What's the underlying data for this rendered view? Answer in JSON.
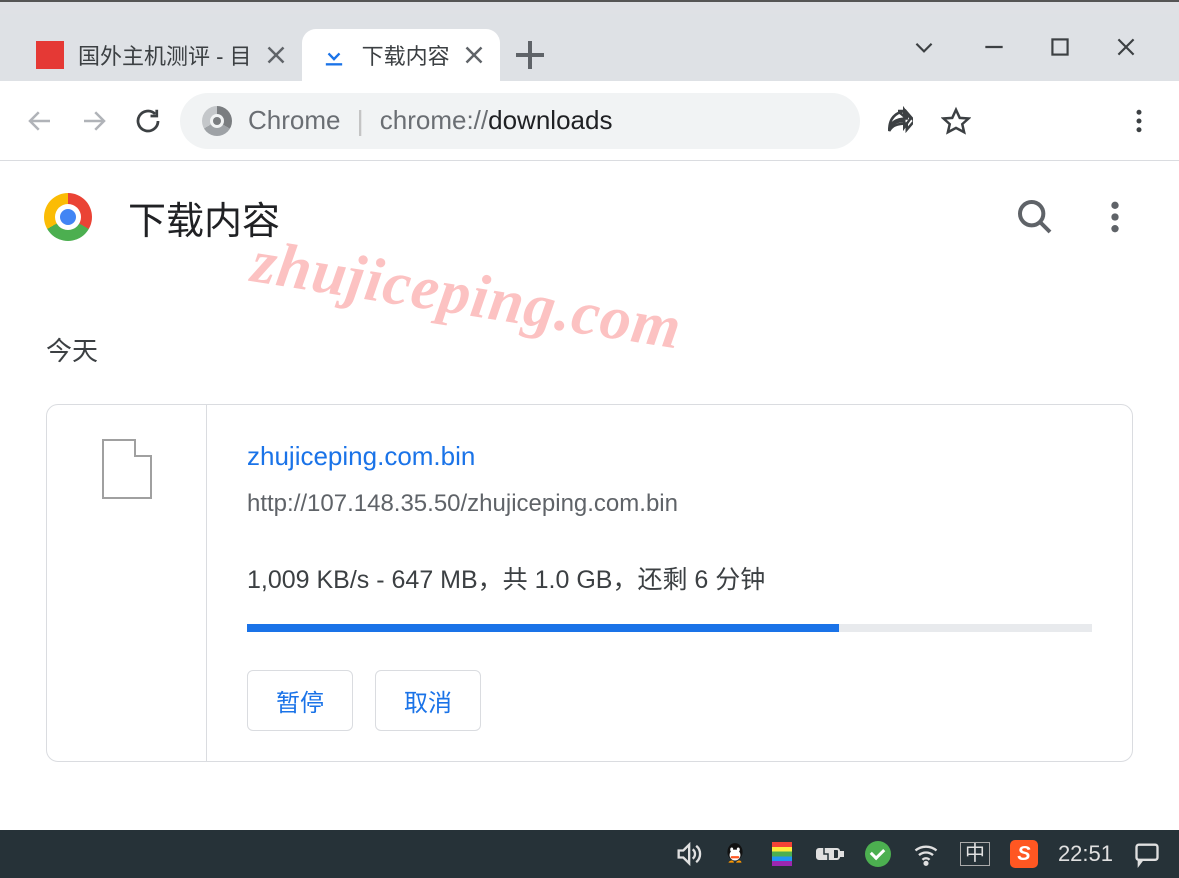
{
  "tabs": {
    "tab0": {
      "title": "国外主机测评 - 目"
    },
    "tab1": {
      "title": "下载内容"
    }
  },
  "omnibox": {
    "host": "Chrome",
    "scheme": "chrome://",
    "page": "downloads"
  },
  "page": {
    "title": "下载内容",
    "section": "今天"
  },
  "download": {
    "filename": "zhujiceping.com.bin",
    "url": "http://107.148.35.50/zhujiceping.com.bin",
    "status": "1,009 KB/s - 647 MB，共 1.0 GB，还剩 6 分钟",
    "progress_pct": 70,
    "pause_label": "暂停",
    "cancel_label": "取消"
  },
  "watermark": "zhujiceping.com",
  "taskbar": {
    "ime": "中",
    "sogou": "S",
    "clock": "22:51"
  }
}
